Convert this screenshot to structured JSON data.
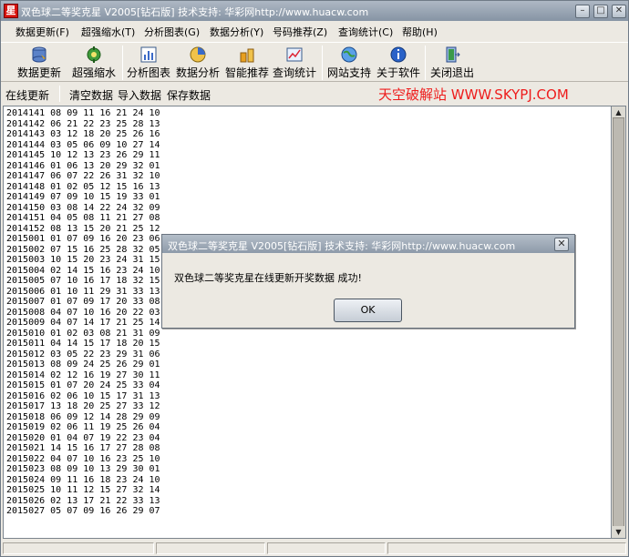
{
  "window": {
    "title": "双色球二等奖克星  V2005[钻石版]  技术支持: 华彩网http://www.huacw.com",
    "min_glyph": "–",
    "max_glyph": "□",
    "close_glyph": "✕",
    "icon_glyph": "星"
  },
  "menu": [
    "数据更新(F)",
    "超强缩水(T)",
    "分析图表(G)",
    "数据分析(Y)",
    "号码推荐(Z)",
    "查询统计(C)",
    "帮助(H)"
  ],
  "toolbar": [
    {
      "label": "数据更新",
      "icon": "database-update-icon"
    },
    {
      "label": "超强缩水",
      "icon": "gear-icon"
    },
    {
      "label": "分析图表",
      "icon": "chart-icon"
    },
    {
      "label": "数据分析",
      "icon": "analysis-icon"
    },
    {
      "label": "智能推荐",
      "icon": "recommend-icon"
    },
    {
      "label": "查询统计",
      "icon": "stats-icon"
    },
    {
      "label": "网站支持",
      "icon": "globe-icon"
    },
    {
      "label": "关于软件",
      "icon": "info-icon"
    },
    {
      "label": "关闭退出",
      "icon": "exit-icon"
    }
  ],
  "actions": [
    "在线更新",
    "清空数据",
    "导入数据",
    "保存数据"
  ],
  "brand_text": "天空破解站 WWW.SKYPJ.COM",
  "data_lines": [
    "2014141 08 09 11 16 21 24 10",
    "2014142 06 21 22 23 25 28 13",
    "2014143 03 12 18 20 25 26 16",
    "2014144 03 05 06 09 10 27 14",
    "2014145 10 12 13 23 26 29 11",
    "2014146 01 06 13 20 29 32 01",
    "2014147 06 07 22 26 31 32 10",
    "2014148 01 02 05 12 15 16 13",
    "2014149 07 09 10 15 19 33 01",
    "2014150 03 08 14 22 24 32 09",
    "2014151 04 05 08 11 21 27 08",
    "2014152 08 13 15 20 21 25 12",
    "2015001 01 07 09 16 20 23 06",
    "2015002 07 15 16 25 28 32 05",
    "2015003 10 15 20 23 24 31 15",
    "2015004 02 14 15 16 23 24 10",
    "2015005 07 10 16 17 18 32 15",
    "2015006 01 10 11 29 31 33 13",
    "2015007 01 07 09 17 20 33 08",
    "2015008 04 07 10 16 20 22 03",
    "2015009 04 07 14 17 21 25 14",
    "2015010 01 02 03 08 21 31 09",
    "2015011 04 14 15 17 18 20 15",
    "2015012 03 05 22 23 29 31 06",
    "2015013 08 09 24 25 26 29 01",
    "2015014 02 12 16 19 27 30 11",
    "2015015 01 07 20 24 25 33 04",
    "2015016 02 06 10 15 17 31 13",
    "2015017 13 18 20 25 27 33 12",
    "2015018 06 09 12 14 28 29 09",
    "2015019 02 06 11 19 25 26 04",
    "2015020 01 04 07 19 22 23 04",
    "2015021 14 15 16 17 27 28 08",
    "2015022 04 07 10 16 23 25 10",
    "2015023 08 09 10 13 29 30 01",
    "2015024 09 11 16 18 23 24 10",
    "2015025 10 11 12 15 27 32 14",
    "2015026 02 13 17 21 22 33 13",
    "2015027 05 07 09 16 26 29 07"
  ],
  "dialog": {
    "title": "双色球二等奖克星  V2005[钻石版]  技术支持: 华彩网http://www.huacw.com",
    "message": "双色球二等奖克星在线更新开奖数据 成功!",
    "ok_label": "OK",
    "close_glyph": "✕"
  },
  "scroll": {
    "up_glyph": "▲",
    "down_glyph": "▼"
  }
}
